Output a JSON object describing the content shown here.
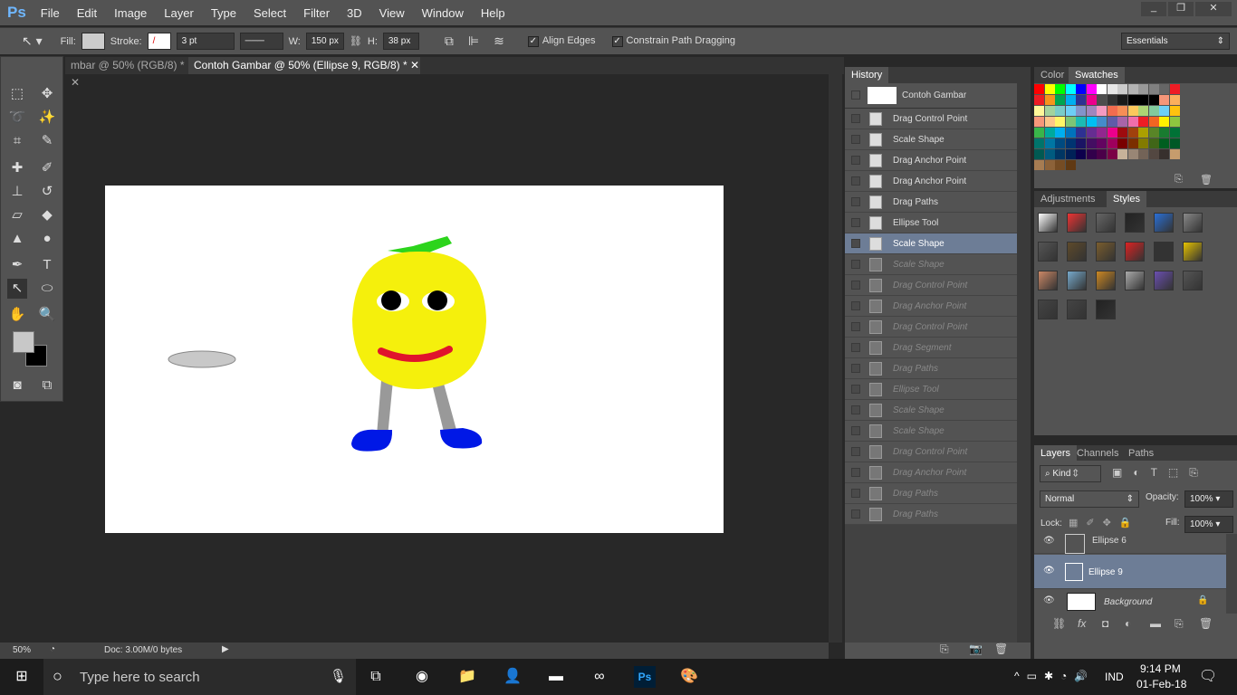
{
  "app": {
    "logo": "Ps",
    "menus": [
      "File",
      "Edit",
      "Image",
      "Layer",
      "Type",
      "Select",
      "Filter",
      "3D",
      "View",
      "Window",
      "Help"
    ],
    "window_controls": [
      "_",
      "❐",
      "✕"
    ]
  },
  "options": {
    "fill_label": "Fill:",
    "stroke_label": "Stroke:",
    "stroke_width": "3 pt",
    "w_label": "W:",
    "w_value": "150 px",
    "h_label": "H:",
    "h_value": "38 px",
    "align_edges": "Align Edges",
    "constrain": "Constrain Path Dragging",
    "workspace": "Essentials"
  },
  "tabs": [
    {
      "label": "mbar @ 50% (RGB/8) *"
    },
    {
      "label": "Contoh Gambar @ 50% (Ellipse 9, RGB/8) *"
    }
  ],
  "status": {
    "zoom": "50%",
    "doc": "Doc: 3.00M/0 bytes"
  },
  "history": {
    "title": "History",
    "snapshot": "Contoh Gambar",
    "items": [
      {
        "label": "Drag Control Point",
        "state": "active"
      },
      {
        "label": "Scale Shape",
        "state": "active"
      },
      {
        "label": "Drag Anchor Point",
        "state": "active"
      },
      {
        "label": "Drag Anchor Point",
        "state": "active"
      },
      {
        "label": "Drag Paths",
        "state": "active"
      },
      {
        "label": "Ellipse Tool",
        "state": "active"
      },
      {
        "label": "Scale Shape",
        "state": "selected"
      },
      {
        "label": "Scale Shape",
        "state": "dim"
      },
      {
        "label": "Drag Control Point",
        "state": "dim"
      },
      {
        "label": "Drag Anchor Point",
        "state": "dim"
      },
      {
        "label": "Drag Control Point",
        "state": "dim"
      },
      {
        "label": "Drag Segment",
        "state": "dim"
      },
      {
        "label": "Drag Paths",
        "state": "dim"
      },
      {
        "label": "Ellipse Tool",
        "state": "dim"
      },
      {
        "label": "Scale Shape",
        "state": "dim"
      },
      {
        "label": "Scale Shape",
        "state": "dim"
      },
      {
        "label": "Drag Control Point",
        "state": "dim"
      },
      {
        "label": "Drag Anchor Point",
        "state": "dim"
      },
      {
        "label": "Drag Paths",
        "state": "dim"
      },
      {
        "label": "Drag Paths",
        "state": "dim"
      }
    ]
  },
  "color_panel": {
    "tabs": [
      "Color",
      "Swatches"
    ],
    "swatches": [
      "#ff0000",
      "#ffff00",
      "#00ff00",
      "#00ffff",
      "#0000ff",
      "#ff00ff",
      "#ffffff",
      "#e6e6e6",
      "#cccccc",
      "#b3b3b3",
      "#999999",
      "#808080",
      "#666666",
      "#ee1c24",
      "#ed1c24",
      "#f7941d",
      "#00a651",
      "#00aeef",
      "#2e3192",
      "#ec008c",
      "#4d4d4d",
      "#333333",
      "#1a1a1a",
      "#000000",
      "#000000",
      "#000000",
      "#f69679",
      "#fbaf5d",
      "#fff799",
      "#a3d39c",
      "#7accc8",
      "#6dcff6",
      "#8393ca",
      "#a186be",
      "#f49ac1",
      "#f26c4f",
      "#f68e56",
      "#fbc85c",
      "#acd373",
      "#82ca9c",
      "#6ecff6",
      "#ffc20e",
      "#f7977a",
      "#fdc689",
      "#fff568",
      "#7cc576",
      "#1cbbb4",
      "#00bff3",
      "#448ccb",
      "#605ca8",
      "#a864a8",
      "#f06eaa",
      "#ed1c24",
      "#f26522",
      "#fff200",
      "#8dc63f",
      "#39b54a",
      "#00a99d",
      "#00aeef",
      "#0072bc",
      "#2e3192",
      "#662d91",
      "#92278f",
      "#ec008c",
      "#9e0b0f",
      "#a0410d",
      "#aba000",
      "#598527",
      "#197b30",
      "#007236",
      "#00746b",
      "#0076a3",
      "#004a80",
      "#003471",
      "#1b1464",
      "#440e62",
      "#630460",
      "#9e005d",
      "#790000",
      "#7b2e00",
      "#827b00",
      "#406618",
      "#005e20",
      "#005826",
      "#005952",
      "#005b7f",
      "#003663",
      "#002157",
      "#0d004c",
      "#32004b",
      "#4b0049",
      "#7b0046",
      "#c7b299",
      "#998675",
      "#736357",
      "#534741",
      "#37302d",
      "#c69c6d",
      "#a67c52",
      "#8c6239",
      "#754c24",
      "#603913"
    ]
  },
  "adjust_panel": {
    "tabs": [
      "Adjustments",
      "Styles"
    ],
    "styles": [
      "#fff",
      "#e33",
      "#666",
      "#222",
      "#2a6fd6",
      "#888",
      "#555",
      "#5e4a2a",
      "#7a5d2d",
      "#d22",
      "#333",
      "#e6c200",
      "#c86",
      "#7ac",
      "#c82",
      "#aaa",
      "#6a4fb0",
      "#555",
      "#444",
      "#444",
      "#222"
    ]
  },
  "layers": {
    "tabs": [
      "Layers",
      "Channels",
      "Paths"
    ],
    "filter": "Kind",
    "blend": "Normal",
    "opacity_label": "Opacity:",
    "opacity": "100%",
    "lock_label": "Lock:",
    "fill_label": "Fill:",
    "fill": "100%",
    "items": [
      {
        "name": "Ellipse 6"
      },
      {
        "name": "Ellipse 9",
        "selected": true
      },
      {
        "name": "Background",
        "locked": true
      }
    ]
  },
  "taskbar": {
    "search": "Type here to search",
    "lang": "IND",
    "time": "9:14 PM",
    "date": "01-Feb-18"
  }
}
